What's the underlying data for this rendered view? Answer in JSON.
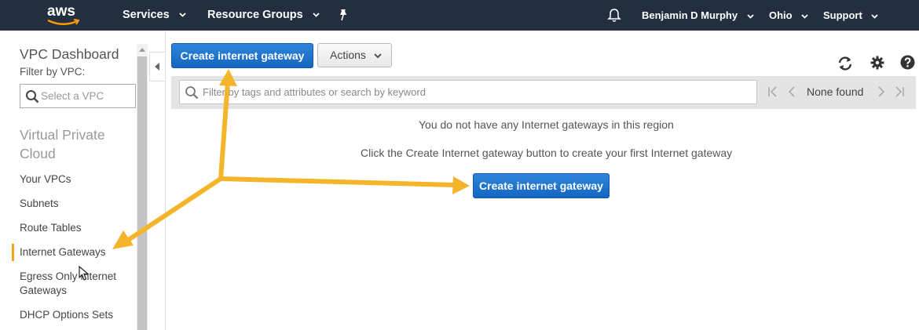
{
  "topnav": {
    "logo_text": "aws",
    "services": "Services",
    "resource_groups": "Resource Groups",
    "user": "Benjamin D Murphy",
    "region": "Ohio",
    "support": "Support"
  },
  "sidebar": {
    "title": "VPC Dashboard",
    "filter_label": "Filter by VPC:",
    "select_placeholder": "Select a VPC",
    "section": "Virtual Private Cloud",
    "items": [
      {
        "label": "Your VPCs"
      },
      {
        "label": "Subnets"
      },
      {
        "label": "Route Tables"
      },
      {
        "label": "Internet Gateways",
        "active": true
      },
      {
        "label": "Egress Only Internet Gateways"
      },
      {
        "label": "DHCP Options Sets"
      }
    ]
  },
  "toolbar": {
    "create_label": "Create internet gateway",
    "actions_label": "Actions"
  },
  "filter": {
    "placeholder": "Filter by tags and attributes or search by keyword",
    "pager_status": "None found"
  },
  "empty_state": {
    "line1": "You do not have any Internet gateways in this region",
    "line2": "Click the Create Internet gateway button to create your first Internet gateway",
    "button": "Create internet gateway"
  },
  "colors": {
    "nav_bg": "#232f3e",
    "primary_button": "#1a73cf",
    "active_marker": "#f7a21b",
    "annotation_arrow": "#f4b52b"
  },
  "icons": [
    "caret-down-icon",
    "pin-icon",
    "bell-icon",
    "search-icon",
    "refresh-icon",
    "gear-icon",
    "help-icon",
    "first-page-icon",
    "prev-page-icon",
    "next-page-icon",
    "last-page-icon",
    "collapse-left-icon",
    "mouse-cursor-icon"
  ]
}
